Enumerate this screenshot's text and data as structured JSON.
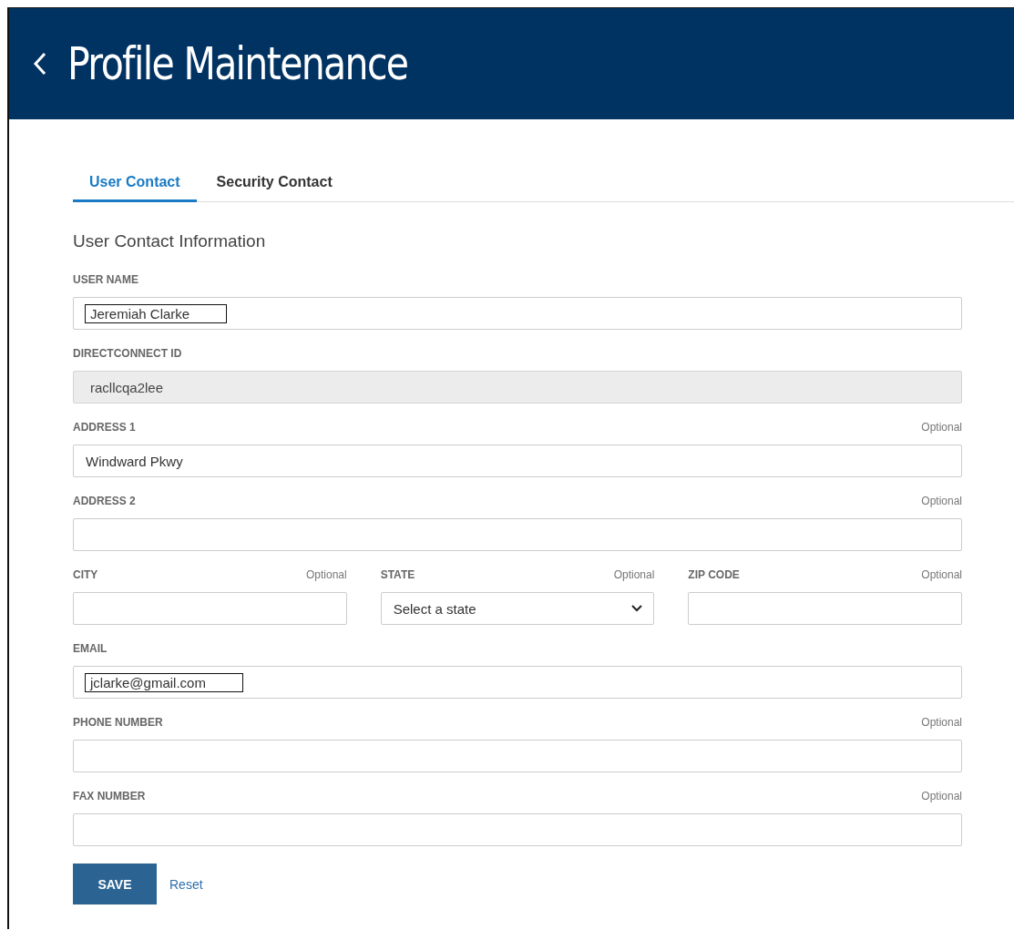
{
  "header": {
    "title": "Profile Maintenance"
  },
  "tabs": [
    {
      "label": "User Contact",
      "selected": true
    },
    {
      "label": "Security Contact",
      "selected": false
    }
  ],
  "section_title": "User Contact Information",
  "rows": [
    {
      "fields": [
        {
          "kind": "text",
          "label": "USER NAME",
          "value": "Jeremiah Clarke",
          "disabled": false,
          "outlined": true
        }
      ]
    },
    {
      "fields": [
        {
          "kind": "text",
          "label": "DIRECTCONNECT ID",
          "value": "racllcqa2lee",
          "disabled": true,
          "outlined": false
        }
      ]
    },
    {
      "fields": [
        {
          "kind": "text",
          "label": "ADDRESS 1",
          "optional": "Optional",
          "value": "Windward Pkwy",
          "disabled": false,
          "outlined": false
        }
      ]
    },
    {
      "fields": [
        {
          "kind": "text",
          "label": "ADDRESS 2",
          "optional": "Optional",
          "disabled": false
        }
      ]
    },
    {
      "fields": [
        {
          "kind": "text",
          "label": "CITY",
          "optional": "Optional",
          "disabled": false
        },
        {
          "kind": "select",
          "label": "STATE",
          "optional": "Optional",
          "value": "Select a state"
        },
        {
          "kind": "text",
          "label": "ZIP CODE",
          "optional": "Optional",
          "disabled": false
        }
      ]
    },
    {
      "fields": [
        {
          "kind": "text",
          "label": "EMAIL",
          "value": "jclarke@gmail.com",
          "disabled": false,
          "outlined": true
        }
      ]
    },
    {
      "fields": [
        {
          "kind": "text",
          "label": "PHONE NUMBER",
          "optional": "Optional",
          "disabled": false
        }
      ]
    },
    {
      "fields": [
        {
          "kind": "text",
          "label": "FAX NUMBER",
          "optional": "Optional",
          "disabled": false
        }
      ]
    }
  ],
  "actions": {
    "save": "SAVE",
    "reset": "Reset"
  }
}
